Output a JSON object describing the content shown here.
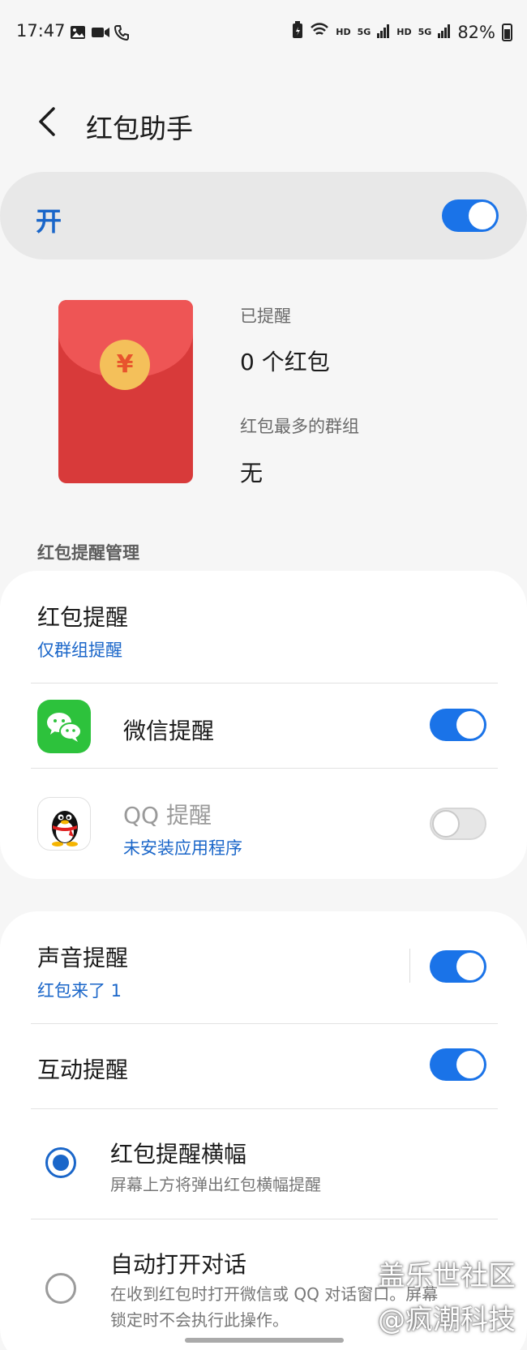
{
  "status_bar": {
    "time": "17:47",
    "hd1": "HD",
    "net1": "5G",
    "hd2": "HD",
    "net2": "5G",
    "battery": "82%"
  },
  "header": {
    "title": "红包助手"
  },
  "master_switch": {
    "label": "开",
    "on": true
  },
  "summary": {
    "reminded_label": "已提醒",
    "reminded_value": "0 个红包",
    "top_group_label": "红包最多的群组",
    "top_group_value": "无",
    "coin_symbol": "¥"
  },
  "section_title": "红包提醒管理",
  "management": {
    "reminder_title": "红包提醒",
    "reminder_sub": "仅群组提醒",
    "wechat": {
      "label": "微信提醒",
      "on": true
    },
    "qq": {
      "label": "QQ 提醒",
      "sub": "未安装应用程序",
      "on": false
    }
  },
  "settings": {
    "sound": {
      "label": "声音提醒",
      "sub": "红包来了 1",
      "on": true
    },
    "interactive": {
      "label": "互动提醒",
      "on": true
    },
    "banner": {
      "label": "红包提醒横幅",
      "desc": "屏幕上方将弹出红包横幅提醒",
      "selected": true
    },
    "auto_open": {
      "label": "自动打开对话",
      "desc_line1": "在收到红包时打开微信或 QQ 对话窗口。屏幕",
      "desc_line2": "锁定时不会执行此操作。",
      "selected": false
    }
  },
  "watermark": {
    "line1": "盖乐世社区",
    "line2": "@疯潮科技"
  },
  "colors": {
    "accent": "#1a73e8",
    "envelope": "#d83a3a",
    "wechat": "#2dc23c"
  }
}
